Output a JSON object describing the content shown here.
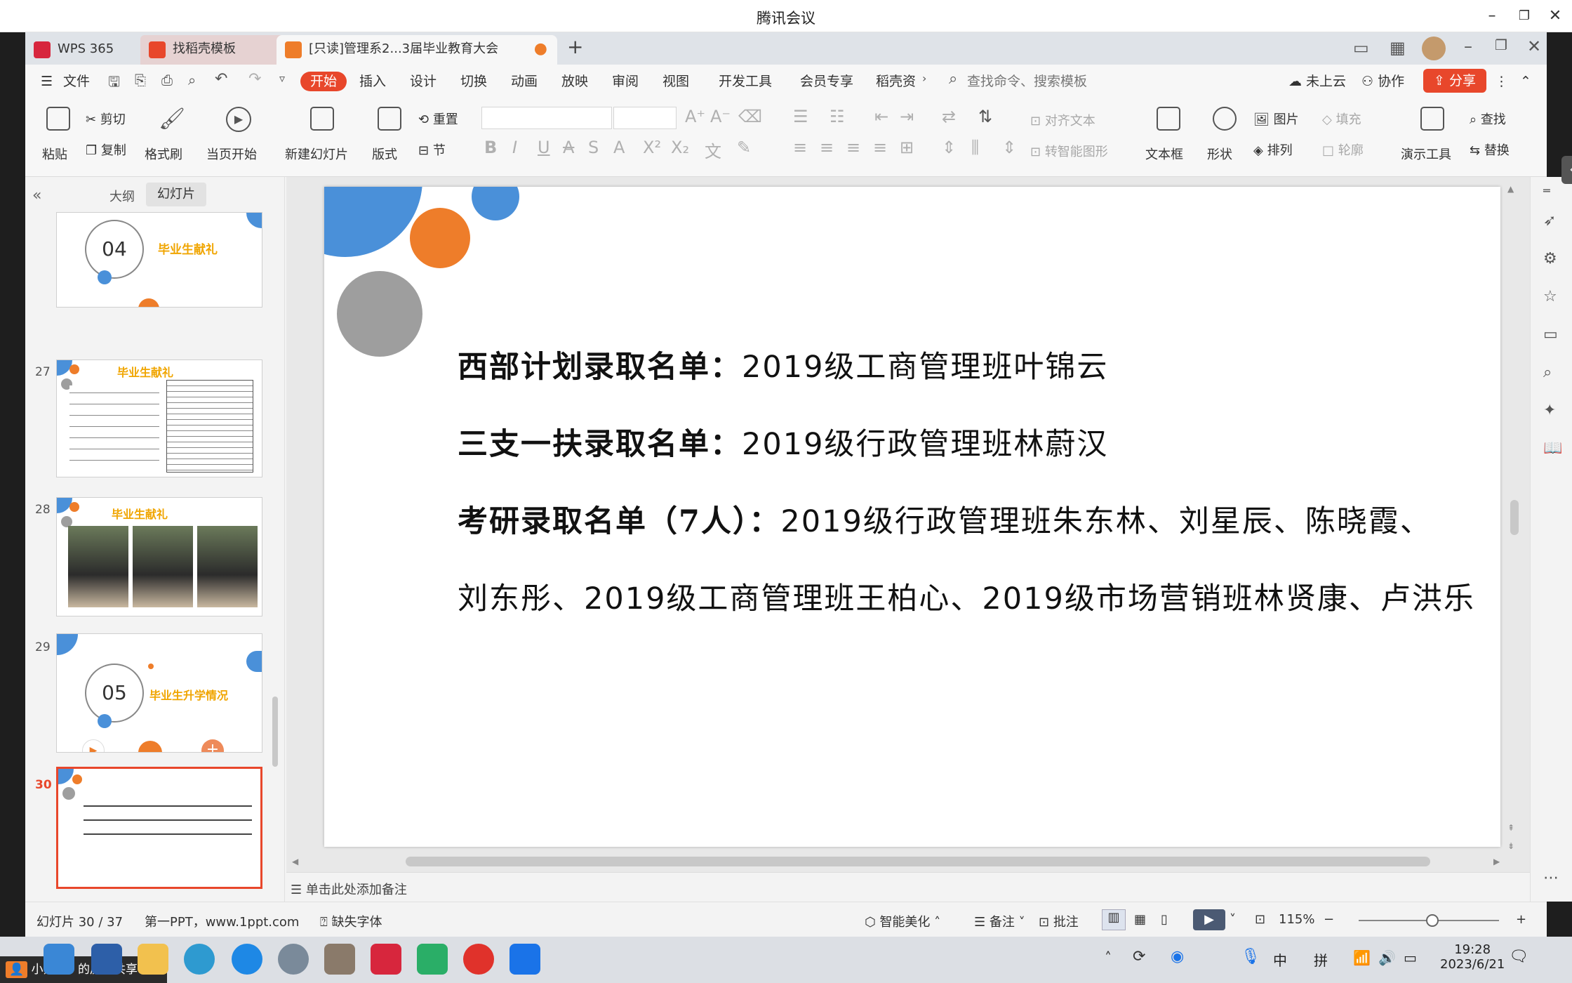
{
  "meeting": {
    "title": "腾讯会议"
  },
  "tabs": [
    {
      "label": "WPS 365"
    },
    {
      "label": "找稻壳模板"
    },
    {
      "label": "[只读]管理系2...3届毕业教育大会"
    }
  ],
  "menu": {
    "file": "文件",
    "items": [
      "开始",
      "插入",
      "设计",
      "切换",
      "动画",
      "放映",
      "审阅",
      "视图",
      "开发工具",
      "会员专享",
      "稻壳资"
    ],
    "search_placeholder": "查找命令、搜索模板",
    "cloud": "未上云",
    "collab": "协作",
    "share": "分享"
  },
  "ribbon": {
    "paste": "粘贴",
    "cut": "剪切",
    "copy": "复制",
    "format_painter": "格式刷",
    "from_current": "当页开始",
    "new_slide": "新建幻灯片",
    "layout": "版式",
    "reset": "重置",
    "section": "节",
    "align_text": "对齐文本",
    "smart_shape": "转智能图形",
    "textbox": "文本框",
    "shape": "形状",
    "picture": "图片",
    "arrange": "排列",
    "fill": "填充",
    "outline": "轮廓",
    "present_tool": "演示工具",
    "find": "查找",
    "replace": "替换"
  },
  "panel": {
    "tab_outline": "大纲",
    "tab_slides": "幻灯片",
    "thumbs": [
      {
        "no": "",
        "num": "04",
        "title": "毕业生献礼"
      },
      {
        "no": "27",
        "title": "毕业生献礼"
      },
      {
        "no": "28",
        "title": "毕业生献礼"
      },
      {
        "no": "29",
        "num": "05",
        "title": "毕业生升学情况"
      },
      {
        "no": "30"
      }
    ]
  },
  "slide": {
    "line1_label": "西部计划录取名单：",
    "line1_value": "2019级工商管理班叶锦云",
    "line2_label": "三支一扶录取名单：",
    "line2_value": "2019级行政管理班林蔚汉",
    "line3_label": "考研录取名单（7人）：",
    "line3_value": "2019级行政管理班朱东林、刘星辰、陈晓霞、",
    "line4_value": "刘东彤、2019级工商管理班王柏心、2019级市场营销班林贤康、卢洪乐"
  },
  "notes_placeholder": "单击此处添加备注",
  "status": {
    "slide_counter": "幻灯片 30 / 37",
    "theme": "第一PPT，www.1ppt.com",
    "missing_font": "缺失字体",
    "beautify": "智能美化",
    "notes": "备注",
    "comment": "批注",
    "zoom": "115%"
  },
  "taskbar": {
    "share_user": "小黑瓶",
    "share_text": "的屏幕共享",
    "ime1": "中",
    "ime2": "拼",
    "time": "19:28",
    "date": "2023/6/21"
  },
  "colors": {
    "accent": "#e8472b",
    "blue": "#4a90d9",
    "orange": "#ee7d2a",
    "gray": "#9e9e9e"
  }
}
